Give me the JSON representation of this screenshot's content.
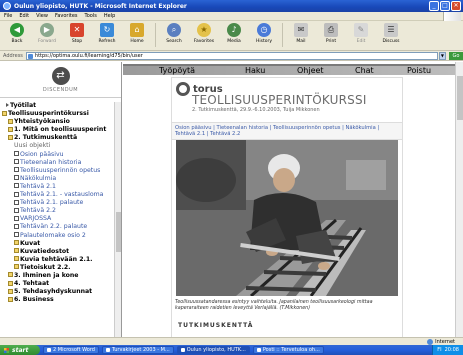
{
  "window": {
    "title": "Oulun yliopisto, HUTK - Microsoft Internet Explorer"
  },
  "menu": [
    "File",
    "Edit",
    "View",
    "Favorites",
    "Tools",
    "Help"
  ],
  "toolbar": {
    "back": "Back",
    "forward": "Forward",
    "stop": "Stop",
    "refresh": "Refresh",
    "home": "Home",
    "search": "Search",
    "favorites": "Favorites",
    "media": "Media",
    "history": "History",
    "mail": "Mail",
    "print": "Print",
    "edit": "Edit",
    "discuss": "Discuss"
  },
  "address": {
    "label": "Address",
    "url": "https://optima.oulu.fi/learning/d75/bin/user",
    "go": "Go"
  },
  "left": {
    "logo_text": "DISCENDUM",
    "tree": [
      {
        "text": "Työtilat",
        "style": "bold",
        "ind": 4,
        "icon": "arrow"
      },
      {
        "text": "Teollisuusperintökurssi",
        "style": "bold",
        "ind": 0,
        "icon": "folder"
      },
      {
        "text": "Yhteistyökansio",
        "style": "bold",
        "ind": 6,
        "icon": "folder"
      },
      {
        "text": "1. Mitä on teollisuusperint",
        "style": "bold",
        "ind": 6,
        "icon": "folder"
      },
      {
        "text": "2. Tutkimuskenttä",
        "style": "bold",
        "ind": 6,
        "icon": "folder"
      },
      {
        "text": "Uusi objekti",
        "style": "gray",
        "ind": 12,
        "icon": ""
      },
      {
        "text": "Osion pääsivu",
        "style": "blue",
        "ind": 12,
        "icon": "doc"
      },
      {
        "text": "Tieteenalan historia",
        "style": "blue",
        "ind": 12,
        "icon": "doc"
      },
      {
        "text": "Teollisuusperinnön opetus",
        "style": "blue",
        "ind": 12,
        "icon": "doc"
      },
      {
        "text": "Näkökulmia",
        "style": "blue",
        "ind": 12,
        "icon": "doc"
      },
      {
        "text": "Tehtävä 2.1",
        "style": "blue",
        "ind": 12,
        "icon": "doc"
      },
      {
        "text": "Tehtävä 2.1. - vastausloma",
        "style": "blue",
        "ind": 12,
        "icon": "doc"
      },
      {
        "text": "Tehtävä 2.1. palaute",
        "style": "blue",
        "ind": 12,
        "icon": "doc"
      },
      {
        "text": "Tehtävä 2.2",
        "style": "blue",
        "ind": 12,
        "icon": "doc"
      },
      {
        "text": "VARJOSSA",
        "style": "blue",
        "ind": 12,
        "icon": "doc"
      },
      {
        "text": "Tehtävän 2.2. palaute",
        "style": "blue",
        "ind": 12,
        "icon": "doc"
      },
      {
        "text": "Palautelomake osio 2",
        "style": "blue",
        "ind": 12,
        "icon": "doc"
      },
      {
        "text": "Kuvat",
        "style": "bold",
        "ind": 12,
        "icon": "folder"
      },
      {
        "text": "Kuvatiedostot",
        "style": "bold",
        "ind": 12,
        "icon": "folder"
      },
      {
        "text": "Kuvia tehtävään 2.1.",
        "style": "bold",
        "ind": 12,
        "icon": "folder"
      },
      {
        "text": "Tietoiskut 2.2.",
        "style": "bold",
        "ind": 12,
        "icon": "folder"
      },
      {
        "text": "3. Ihminen ja kone",
        "style": "bold",
        "ind": 6,
        "icon": "folder"
      },
      {
        "text": "4. Tehtaat",
        "style": "bold",
        "ind": 6,
        "icon": "folder"
      },
      {
        "text": "5. Tehdasyhdyskunnat",
        "style": "bold",
        "ind": 6,
        "icon": "folder"
      },
      {
        "text": "6. Business",
        "style": "bold",
        "ind": 6,
        "icon": "folder"
      }
    ]
  },
  "nav": {
    "workspace": "Työpöytä",
    "search": "Haku",
    "help": "Ohjeet",
    "chat": "Chat",
    "logout": "Poistu"
  },
  "page": {
    "brand": "torus",
    "title": "TEOLLISUUSPERINTÖKURSSI",
    "subtitle": "2. Tutkimuskenttä, 29.9.-6.10.2003, Tuija Mikkonen",
    "breadcrumb": "Osion pääsivu | Tieteenalan historia | Teollisuusperinnön opetus | Näkökulmia | Tehtävä 2.1 | Tehtävä 2.2",
    "caption": "Teollisuussatandaressa esintyy vaihteluita. Japanilainen teollisuusarkeologi mittaa kaperaraiteen raidetien leveyttä Verlajällä. (T.Mikkonen)",
    "section_heading": "TUTKIMUSKENTTÄ"
  },
  "status": {
    "zone": "Internet"
  },
  "taskbar": {
    "start": "start",
    "tasks": [
      "2 Microsoft Word",
      "Turvakirjeet 2003 - M...",
      "Oulun yliopisto, HUTK...",
      "Posti :: Tervetuloa oh..."
    ],
    "clock": "20:08",
    "lang": "FI"
  }
}
